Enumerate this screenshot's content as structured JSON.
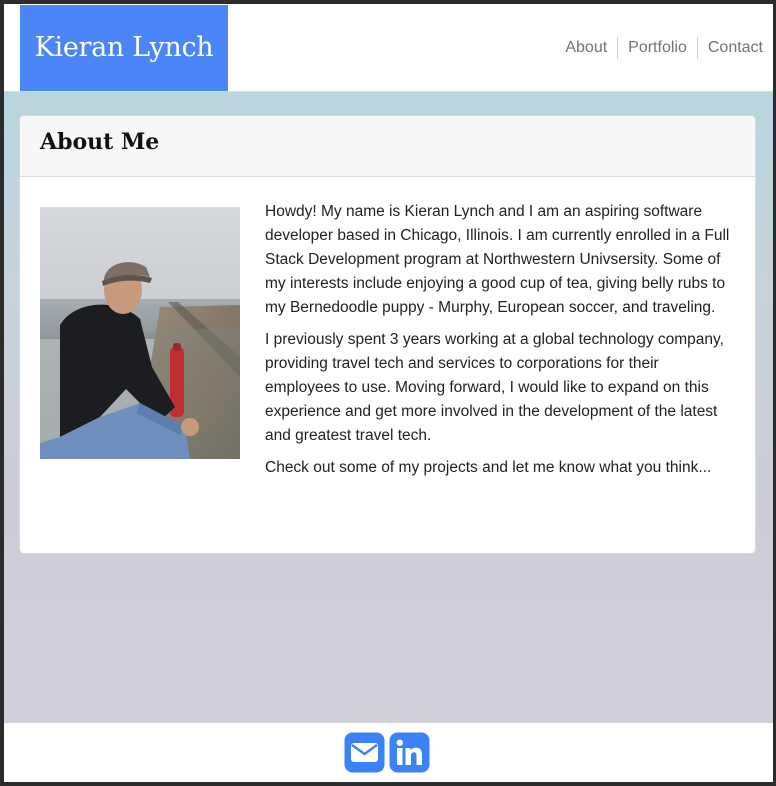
{
  "site": {
    "brand": "Kieran Lynch"
  },
  "nav": {
    "items": [
      {
        "label": "About"
      },
      {
        "label": "Portfolio"
      },
      {
        "label": "Contact"
      }
    ]
  },
  "about": {
    "title": "About Me",
    "photo": {
      "icon": "profile-photo"
    },
    "paragraphs": [
      "Howdy! My name is Kieran Lynch and I am an aspiring software developer based in Chicago, Illinois. I am currently enrolled in a Full Stack Development program at Northwestern Univsersity. Some of my interests include enjoying a good cup of tea, giving belly rubs to my Bernedoodle puppy - Murphy, European soccer, and traveling.",
      "I previously spent 3 years working at a global technology company, providing travel tech and services to corporations for their employees to use. Moving forward, I would like to expand on this experience and get more involved in the development of the latest and greatest travel tech.",
      "Check out some of my projects and let me know what you think..."
    ]
  },
  "footer": {
    "links": [
      {
        "icon": "envelope-icon"
      },
      {
        "icon": "linkedin-icon"
      }
    ]
  },
  "colors": {
    "brand": "#4a86f7",
    "nav_text": "#6c757d",
    "icon_blue": "#3b82f6"
  }
}
